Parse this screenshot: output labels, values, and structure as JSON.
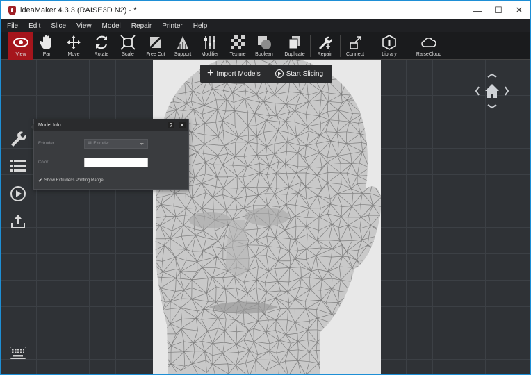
{
  "window": {
    "title": "ideaMaker 4.3.3 (RAISE3D N2) - *"
  },
  "menu": [
    "File",
    "Edit",
    "Slice",
    "View",
    "Model",
    "Repair",
    "Printer",
    "Help"
  ],
  "toolbar": {
    "view": "View",
    "pan": "Pan",
    "move": "Move",
    "rotate": "Rotate",
    "scale": "Scale",
    "free_cut": "Free Cut",
    "support": "Support",
    "modifier": "Modifier",
    "texture": "Texture",
    "boolean": "Boolean",
    "duplicate": "Duplicate",
    "repair": "Repair",
    "connect": "Connect",
    "library": "Library",
    "raisecloud": "RaiseCloud"
  },
  "actions": {
    "import": "Import Models",
    "slice": "Start Slicing"
  },
  "model_info": {
    "title": "Model Info",
    "help": "?",
    "close": "✕",
    "extruder_label": "Extruder",
    "extruder_value": "All Extruder",
    "color_label": "Color",
    "show_range": "Show Extruder's Printing Range"
  },
  "colors": {
    "accent": "#a5151c",
    "viewport": "#2f3236",
    "render_bg": "#e8e8e8"
  }
}
